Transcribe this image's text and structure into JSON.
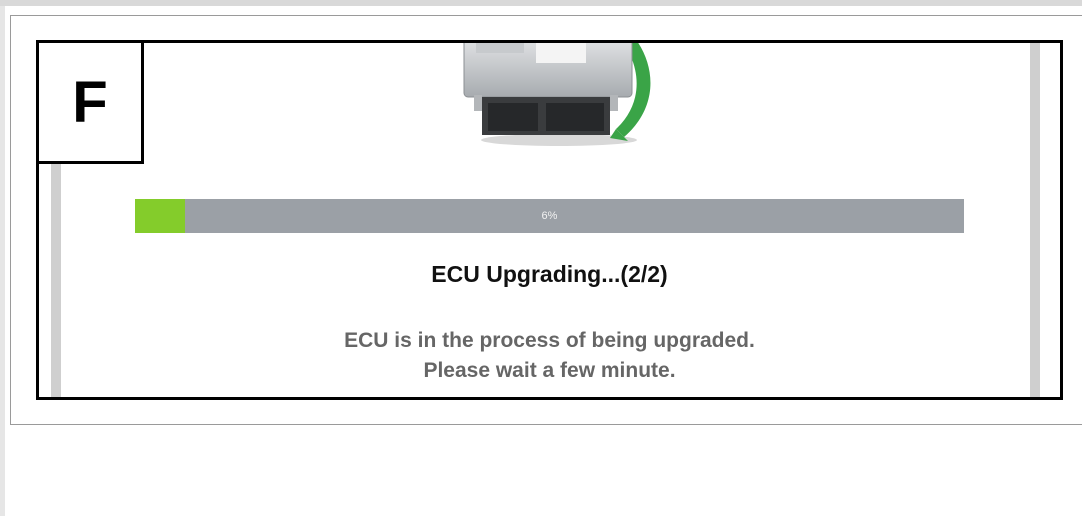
{
  "step_label": "F",
  "progress": {
    "percent": 6,
    "label": "6%"
  },
  "dialog": {
    "title": "ECU Upgrading...(2/2)",
    "message_line1": "ECU is in the process of being upgraded.",
    "message_line2": "Please wait a few minute."
  },
  "icons": {
    "device": "ecu-module-icon"
  },
  "colors": {
    "progress_fill": "#84cc2b",
    "progress_track": "#9ba0a6",
    "message_text": "#666666",
    "arrow": "#3aa447"
  }
}
